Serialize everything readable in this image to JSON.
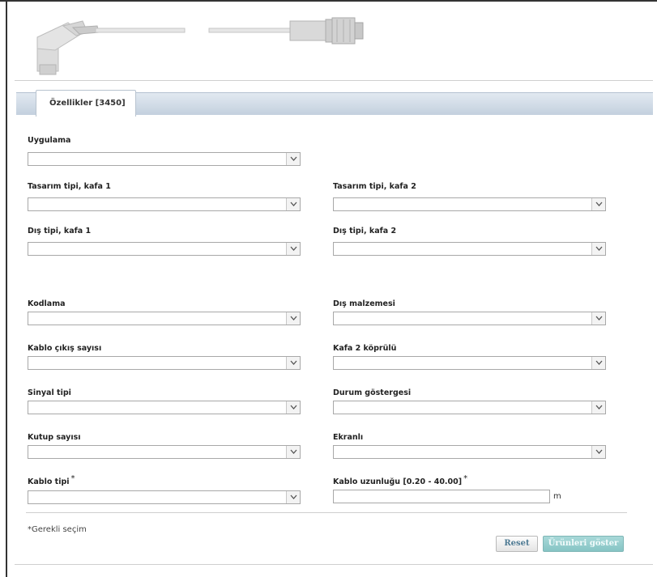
{
  "tab": {
    "label": "Özellikler [3450]"
  },
  "fields": {
    "uygulama": {
      "label": "Uygulama",
      "value": ""
    },
    "tasarim_kafa1": {
      "label": "Tasarım tipi, kafa 1",
      "value": ""
    },
    "tasarim_kafa2": {
      "label": "Tasarım tipi, kafa 2",
      "value": ""
    },
    "dis_kafa1": {
      "label": "Dış tipi, kafa 1",
      "value": ""
    },
    "dis_kafa2": {
      "label": "Dış tipi, kafa 2",
      "value": ""
    },
    "kodlama": {
      "label": "Kodlama",
      "value": ""
    },
    "dis_malzemesi": {
      "label": "Dış malzemesi",
      "value": ""
    },
    "kablo_cikis": {
      "label": "Kablo çıkış sayısı",
      "value": ""
    },
    "kafa2_kopru": {
      "label": "Kafa 2 köprülü",
      "value": ""
    },
    "sinyal_tipi": {
      "label": "Sinyal tipi",
      "value": ""
    },
    "durum_gostergesi": {
      "label": "Durum göstergesi",
      "value": ""
    },
    "kutup_sayisi": {
      "label": "Kutup sayısı",
      "value": ""
    },
    "ekranli": {
      "label": "Ekranlı",
      "value": ""
    },
    "kablo_tipi": {
      "label": "Kablo tipi",
      "required_mark": "*",
      "value": ""
    },
    "kablo_uzunlugu": {
      "label": "Kablo uzunluğu [0.20 - 40.00]",
      "required_mark": "*",
      "value": "",
      "unit": "m"
    }
  },
  "footer": {
    "required_note": "*Gerekli seçim",
    "reset_label": "Reset",
    "show_label": "Ürünleri göster"
  },
  "colors": {
    "tab_bar": "#c3d0de",
    "reset_text": "#4f7b94",
    "show_button": "#86c4c4"
  },
  "icons": {
    "dropdown": "chevron-down-icon"
  }
}
